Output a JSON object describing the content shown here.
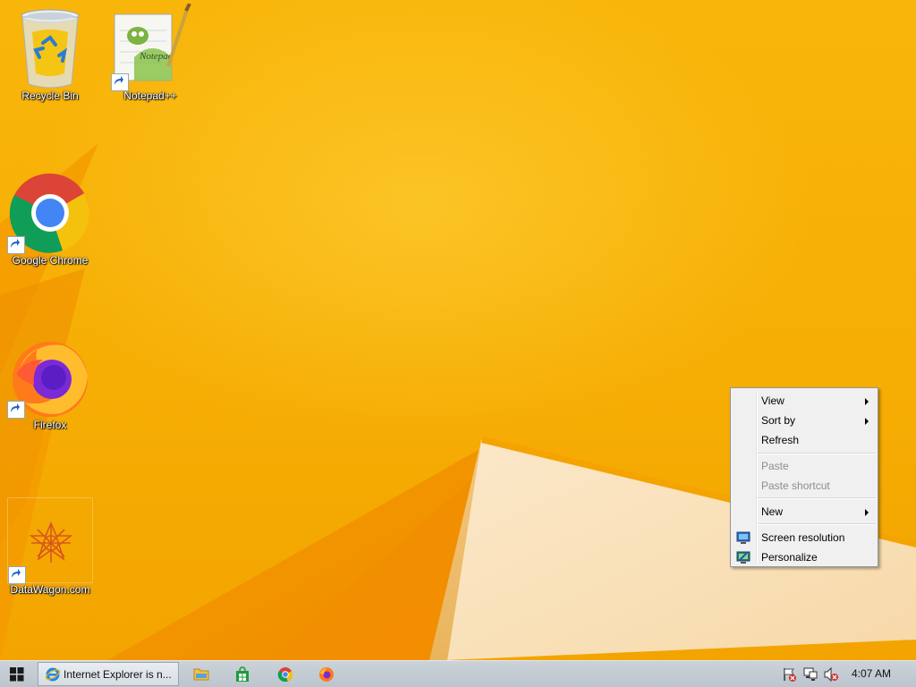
{
  "desktop": {
    "icons": [
      {
        "label": "Recycle Bin"
      },
      {
        "label": "Notepad++"
      },
      {
        "label": "Google Chrome"
      },
      {
        "label": "Firefox"
      },
      {
        "label": "DataWagon.com"
      }
    ]
  },
  "context_menu": {
    "items": [
      {
        "label": "View",
        "has_submenu": true
      },
      {
        "label": "Sort by",
        "has_submenu": true
      },
      {
        "label": "Refresh"
      },
      {
        "label": "Paste",
        "disabled": true
      },
      {
        "label": "Paste shortcut",
        "disabled": true
      },
      {
        "label": "New",
        "has_submenu": true
      },
      {
        "label": "Screen resolution",
        "icon": "screen-resolution-icon"
      },
      {
        "label": "Personalize",
        "icon": "personalize-icon"
      }
    ]
  },
  "taskbar": {
    "active_window": {
      "label": "Internet Explorer is n..."
    },
    "pinned": [
      "file-explorer-icon",
      "store-icon",
      "chrome-icon",
      "firefox-icon"
    ],
    "tray": [
      "action-center-flag-icon",
      "network-icon",
      "volume-muted-icon"
    ],
    "clock": "4:07 AM"
  },
  "colors": {
    "wallpaper": "#f6ae04",
    "menu_background": "#f0f0f0",
    "taskbar": "#c3cbd3"
  }
}
